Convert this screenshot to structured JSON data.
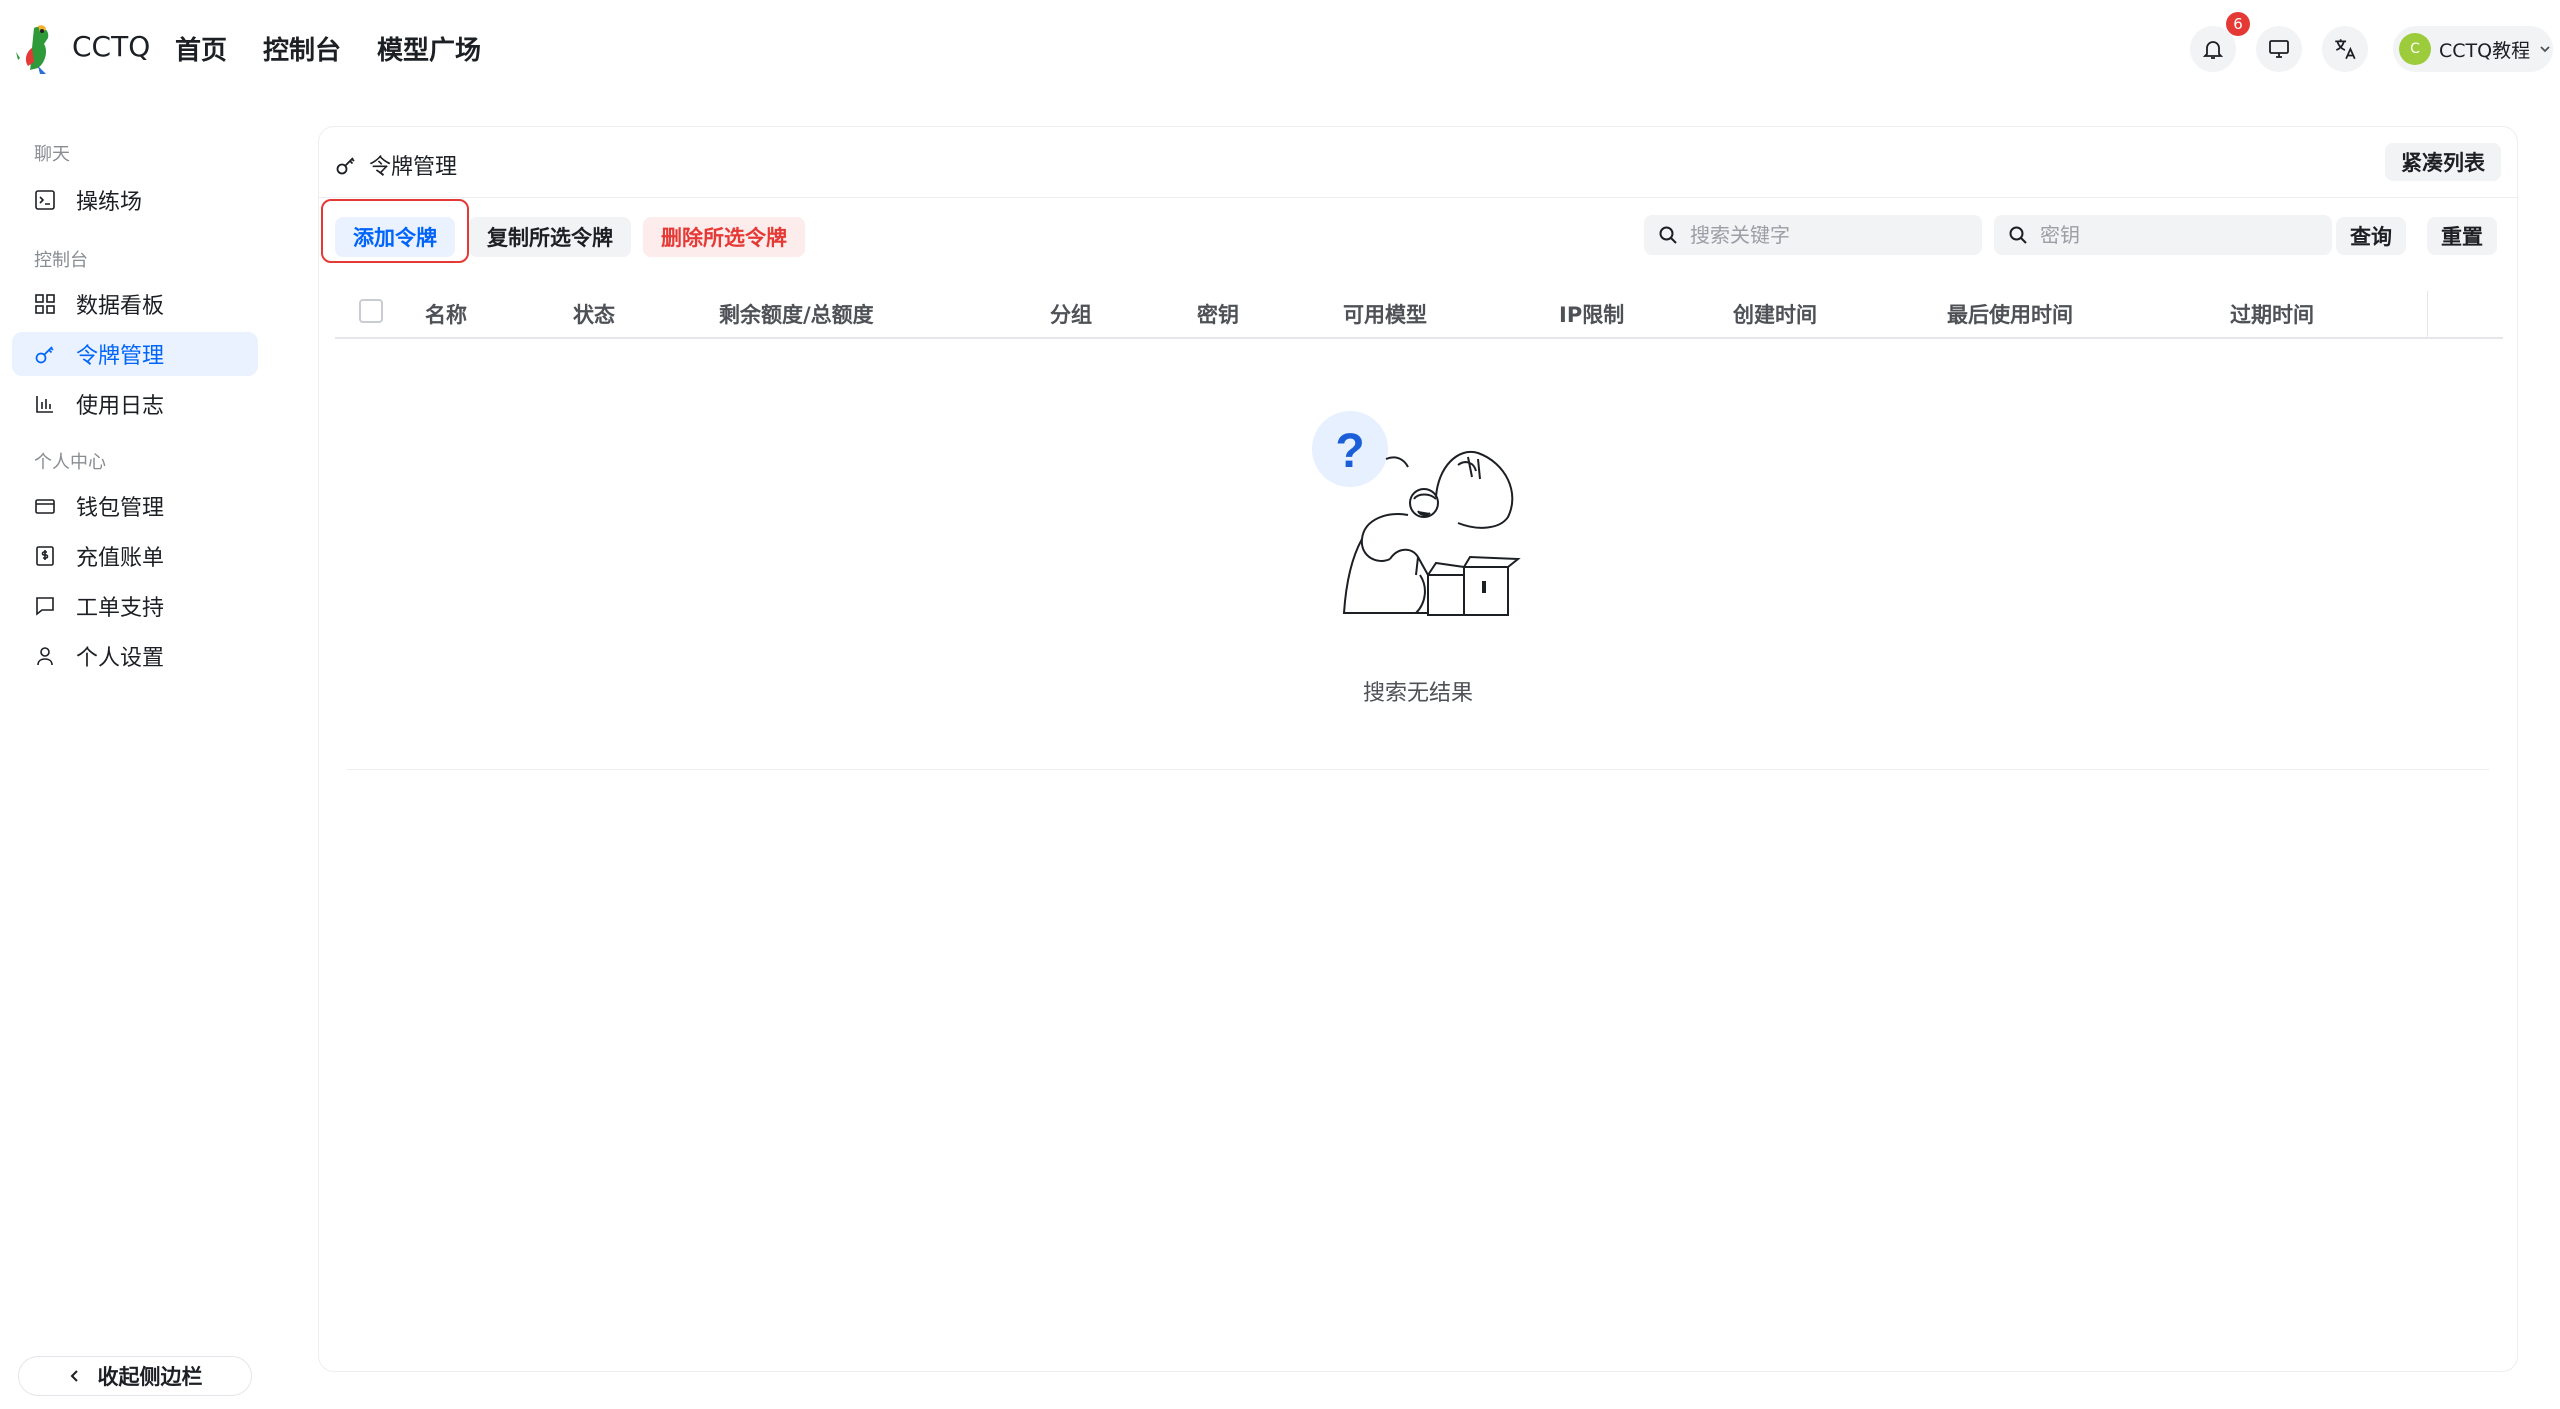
{
  "header": {
    "brand": "CCTQ",
    "nav": [
      "首页",
      "控制台",
      "模型广场"
    ],
    "notification_count": "6",
    "user": {
      "avatar_letter": "C",
      "name": "CCTQ教程"
    }
  },
  "sidebar": {
    "sections": [
      {
        "title": "聊天",
        "items": [
          {
            "label": "操练场",
            "icon": "terminal-icon"
          }
        ]
      },
      {
        "title": "控制台",
        "items": [
          {
            "label": "数据看板",
            "icon": "dashboard-icon"
          },
          {
            "label": "令牌管理",
            "icon": "key-icon",
            "active": true
          },
          {
            "label": "使用日志",
            "icon": "bar-chart-icon"
          }
        ]
      },
      {
        "title": "个人中心",
        "items": [
          {
            "label": "钱包管理",
            "icon": "wallet-icon"
          },
          {
            "label": "充值账单",
            "icon": "receipt-icon"
          },
          {
            "label": "工单支持",
            "icon": "chat-icon"
          },
          {
            "label": "个人设置",
            "icon": "user-icon"
          }
        ]
      }
    ],
    "collapse_label": "收起侧边栏"
  },
  "page": {
    "title": "令牌管理",
    "compact_label": "紧凑列表",
    "toolbar": {
      "add_label": "添加令牌",
      "copy_label": "复制所选令牌",
      "delete_label": "删除所选令牌",
      "keyword_placeholder": "搜索关键字",
      "key_placeholder": "密钥",
      "query_label": "查询",
      "reset_label": "重置"
    },
    "table": {
      "columns": [
        "名称",
        "状态",
        "剩余额度/总额度",
        "分组",
        "密钥",
        "可用模型",
        "IP限制",
        "创建时间",
        "最后使用时间",
        "过期时间"
      ]
    },
    "empty_text": "搜索无结果"
  },
  "colors": {
    "accent": "#0064fa",
    "danger": "#e53935",
    "highlight_outline": "#e53935"
  }
}
